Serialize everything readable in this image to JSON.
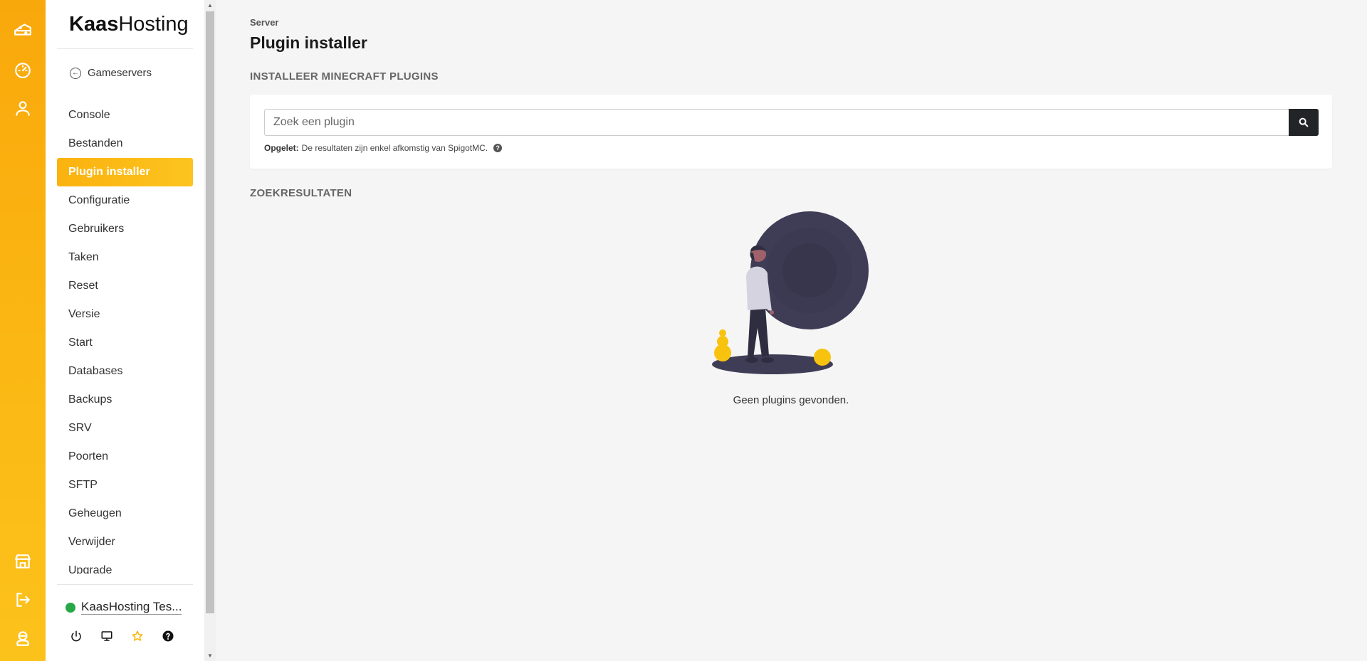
{
  "rail": {
    "icons": [
      "cheese-logo-icon",
      "dashboard-gauge-icon",
      "user-icon",
      "store-icon",
      "logout-icon",
      "support-agent-icon"
    ]
  },
  "sidebar": {
    "brand_bold": "Kaas",
    "brand_light": "Hosting",
    "back_label": "Gameservers",
    "items": [
      {
        "label": "Console"
      },
      {
        "label": "Bestanden"
      },
      {
        "label": "Plugin installer",
        "active": true
      },
      {
        "label": "Configuratie"
      },
      {
        "label": "Gebruikers"
      },
      {
        "label": "Taken"
      },
      {
        "label": "Reset"
      },
      {
        "label": "Versie"
      },
      {
        "label": "Start"
      },
      {
        "label": "Databases"
      },
      {
        "label": "Backups"
      },
      {
        "label": "SRV"
      },
      {
        "label": "Poorten"
      },
      {
        "label": "SFTP"
      },
      {
        "label": "Geheugen"
      },
      {
        "label": "Verwijder"
      },
      {
        "label": "Upgrade"
      }
    ],
    "server_name": "KaasHosting Tes...",
    "server_status_color": "#28a745",
    "actions": [
      "power-icon",
      "monitor-icon",
      "star-icon",
      "help-icon"
    ]
  },
  "page": {
    "pretitle": "Server",
    "title": "Plugin installer",
    "section_install": "INSTALLEER MINECRAFT PLUGINS",
    "search_placeholder": "Zoek een plugin",
    "note_bold": "Opgelet:",
    "note_text": "De resultaten zijn enkel afkomstig van SpigotMC.",
    "section_results": "ZOEKRESULTATEN",
    "empty_text": "Geen plugins gevonden."
  },
  "colors": {
    "accent": "#fbb814",
    "dark": "#222428",
    "illustration_dark": "#3f3d56"
  }
}
